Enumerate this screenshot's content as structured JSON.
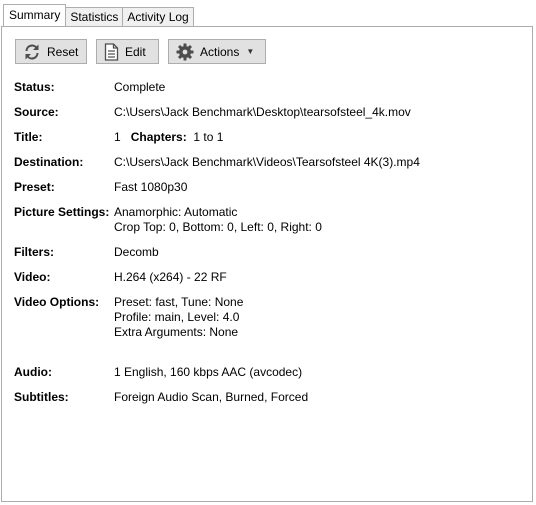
{
  "tabs": [
    {
      "label": "Summary",
      "active": true
    },
    {
      "label": "Statistics",
      "active": false
    },
    {
      "label": "Activity Log",
      "active": false
    }
  ],
  "toolbar": {
    "reset_label": "Reset",
    "edit_label": "Edit",
    "actions_label": "Actions"
  },
  "details": {
    "status": {
      "label": "Status:",
      "value": "Complete"
    },
    "source": {
      "label": "Source:",
      "value": "C:\\Users\\Jack Benchmark\\Desktop\\tearsofsteel_4k.mov"
    },
    "title": {
      "label": "Title:",
      "title_num": "1",
      "chapters_label": "Chapters:",
      "chapters_value": "1  to  1"
    },
    "destination": {
      "label": "Destination:",
      "value": "C:\\Users\\Jack Benchmark\\Videos\\Tearsofsteel 4K(3).mp4"
    },
    "preset": {
      "label": "Preset:",
      "value": "Fast 1080p30"
    },
    "picture": {
      "label": "Picture Settings:",
      "line1": "Anamorphic: Automatic",
      "line2": "Crop Top: 0, Bottom: 0, Left: 0, Right: 0"
    },
    "filters": {
      "label": "Filters:",
      "value": "Decomb"
    },
    "video": {
      "label": "Video:",
      "value": "H.264 (x264) - 22 RF"
    },
    "video_options": {
      "label": "Video Options:",
      "line1": "Preset: fast, Tune: None",
      "line2": "Profile: main, Level: 4.0",
      "line3": "Extra Arguments: None"
    },
    "audio": {
      "label": "Audio:",
      "value": "1 English, 160 kbps AAC (avcodec)"
    },
    "subtitles": {
      "label": "Subtitles:",
      "value": "Foreign Audio Scan, Burned, Forced"
    }
  },
  "icons": {
    "reset": "refresh-icon",
    "edit": "document-icon",
    "actions": "gear-icon",
    "dropdown": "caret-down-icon"
  },
  "colors": {
    "border": "#adadad",
    "button_bg": "#e1e1e1",
    "icon": "#4d4d4d"
  }
}
